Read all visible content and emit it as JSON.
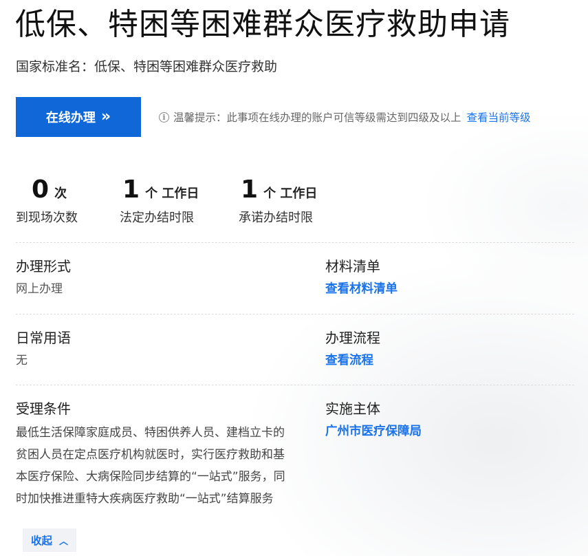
{
  "header": {
    "title": "低保、特困等困难群众医疗救助申请",
    "standard_name": "国家标准名：低保、特困等困难群众医疗救助"
  },
  "actions": {
    "online_label": "在线办理",
    "online_icon": "double-chevron-right-icon",
    "tip_icon": "info-circle-icon",
    "tip_text": "温馨提示：此事项在线办理的账户可信等级需达到四级及以上",
    "tip_link": "查看当前等级"
  },
  "stats": [
    {
      "value": "0",
      "unit": "次",
      "label": "到现场次数"
    },
    {
      "value": "1",
      "unit": "个 工作日",
      "label": "法定办结时限"
    },
    {
      "value": "1",
      "unit": "个 工作日",
      "label": "承诺办结时限"
    }
  ],
  "details": {
    "handle_form": {
      "title": "办理形式",
      "value": "网上办理"
    },
    "materials": {
      "title": "材料清单",
      "link": "查看材料清单"
    },
    "common_terms": {
      "title": "日常用语",
      "value": "无"
    },
    "process": {
      "title": "办理流程",
      "link": "查看流程"
    },
    "conditions": {
      "title": "受理条件",
      "value": "最低生活保障家庭成员、特困供养人员、建档立卡的贫困人员在定点医疗机构就医时，实行医疗救助和基本医疗保险、大病保险同步结算的“一站式”服务，同时加快推进重特大疾病医疗救助“一站式”结算服务"
    },
    "implementer": {
      "title": "实施主体",
      "link": "广州市医疗保障局"
    }
  },
  "collapse": {
    "label": "收起",
    "icon": "chevron-up-icon"
  },
  "colors": {
    "primary": "#1068d8",
    "link": "#1a73e8"
  }
}
